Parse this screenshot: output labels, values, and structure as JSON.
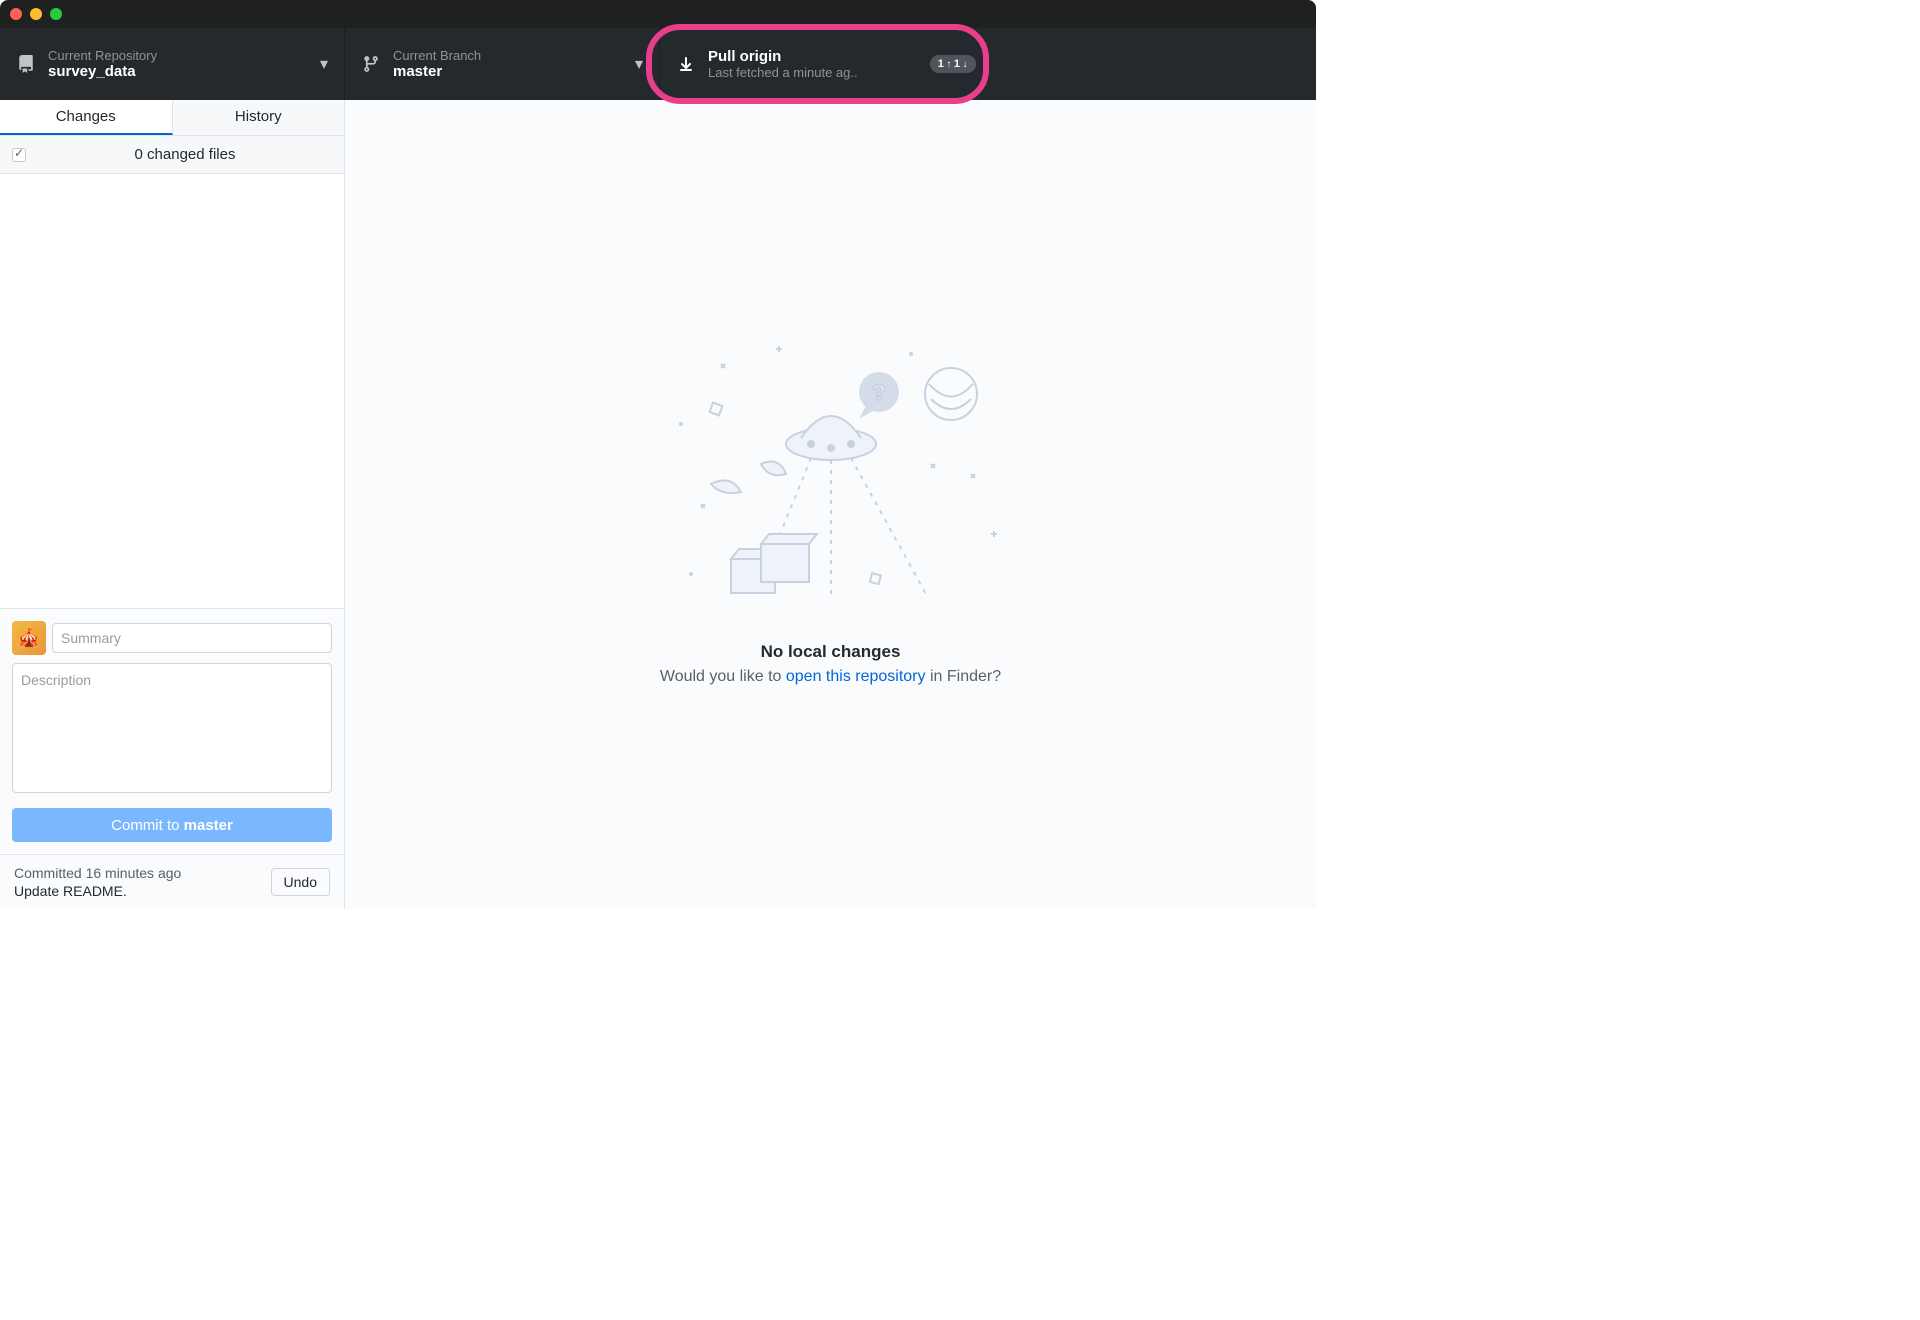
{
  "toolbar": {
    "repo": {
      "label": "Current Repository",
      "value": "survey_data"
    },
    "branch": {
      "label": "Current Branch",
      "value": "master"
    },
    "pull": {
      "label": "Pull origin",
      "value": "Last fetched a minute ag..",
      "badge_push": "1",
      "badge_pull": "1"
    }
  },
  "sidebar": {
    "tabs": {
      "changes": "Changes",
      "history": "History"
    },
    "changed_files": "0 changed files"
  },
  "commit": {
    "summary_placeholder": "Summary",
    "description_placeholder": "Description",
    "button_prefix": "Commit to ",
    "button_branch": "master"
  },
  "last_commit": {
    "time": "Committed 16 minutes ago",
    "message": "Update README.",
    "undo": "Undo"
  },
  "empty": {
    "title": "No local changes",
    "prefix": "Would you like to ",
    "link": "open this repository",
    "suffix": " in Finder?"
  }
}
